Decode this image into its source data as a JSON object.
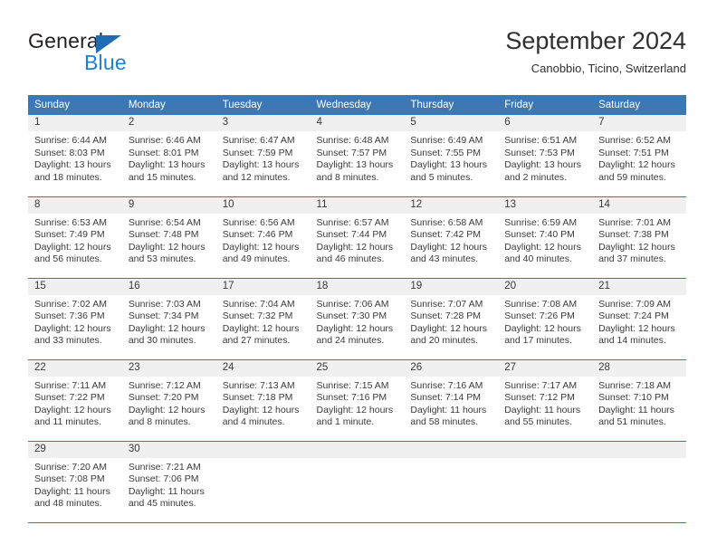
{
  "brand": {
    "name_part1": "General",
    "name_part2": "Blue",
    "triangle_color": "#1f6cb4",
    "blue_text_color": "#1f7fd4"
  },
  "header": {
    "title": "September 2024",
    "subtitle": "Canobbio, Ticino, Switzerland"
  },
  "theme": {
    "header_blue": "#3c78b4",
    "daynum_band": "#f0f0f0",
    "text": "#3a3a3a"
  },
  "columns": [
    "Sunday",
    "Monday",
    "Tuesday",
    "Wednesday",
    "Thursday",
    "Friday",
    "Saturday"
  ],
  "weeks": [
    [
      {
        "day": "1",
        "sunrise": "Sunrise: 6:44 AM",
        "sunset": "Sunset: 8:03 PM",
        "daylight1": "Daylight: 13 hours",
        "daylight2": "and 18 minutes."
      },
      {
        "day": "2",
        "sunrise": "Sunrise: 6:46 AM",
        "sunset": "Sunset: 8:01 PM",
        "daylight1": "Daylight: 13 hours",
        "daylight2": "and 15 minutes."
      },
      {
        "day": "3",
        "sunrise": "Sunrise: 6:47 AM",
        "sunset": "Sunset: 7:59 PM",
        "daylight1": "Daylight: 13 hours",
        "daylight2": "and 12 minutes."
      },
      {
        "day": "4",
        "sunrise": "Sunrise: 6:48 AM",
        "sunset": "Sunset: 7:57 PM",
        "daylight1": "Daylight: 13 hours",
        "daylight2": "and 8 minutes."
      },
      {
        "day": "5",
        "sunrise": "Sunrise: 6:49 AM",
        "sunset": "Sunset: 7:55 PM",
        "daylight1": "Daylight: 13 hours",
        "daylight2": "and 5 minutes."
      },
      {
        "day": "6",
        "sunrise": "Sunrise: 6:51 AM",
        "sunset": "Sunset: 7:53 PM",
        "daylight1": "Daylight: 13 hours",
        "daylight2": "and 2 minutes."
      },
      {
        "day": "7",
        "sunrise": "Sunrise: 6:52 AM",
        "sunset": "Sunset: 7:51 PM",
        "daylight1": "Daylight: 12 hours",
        "daylight2": "and 59 minutes."
      }
    ],
    [
      {
        "day": "8",
        "sunrise": "Sunrise: 6:53 AM",
        "sunset": "Sunset: 7:49 PM",
        "daylight1": "Daylight: 12 hours",
        "daylight2": "and 56 minutes."
      },
      {
        "day": "9",
        "sunrise": "Sunrise: 6:54 AM",
        "sunset": "Sunset: 7:48 PM",
        "daylight1": "Daylight: 12 hours",
        "daylight2": "and 53 minutes."
      },
      {
        "day": "10",
        "sunrise": "Sunrise: 6:56 AM",
        "sunset": "Sunset: 7:46 PM",
        "daylight1": "Daylight: 12 hours",
        "daylight2": "and 49 minutes."
      },
      {
        "day": "11",
        "sunrise": "Sunrise: 6:57 AM",
        "sunset": "Sunset: 7:44 PM",
        "daylight1": "Daylight: 12 hours",
        "daylight2": "and 46 minutes."
      },
      {
        "day": "12",
        "sunrise": "Sunrise: 6:58 AM",
        "sunset": "Sunset: 7:42 PM",
        "daylight1": "Daylight: 12 hours",
        "daylight2": "and 43 minutes."
      },
      {
        "day": "13",
        "sunrise": "Sunrise: 6:59 AM",
        "sunset": "Sunset: 7:40 PM",
        "daylight1": "Daylight: 12 hours",
        "daylight2": "and 40 minutes."
      },
      {
        "day": "14",
        "sunrise": "Sunrise: 7:01 AM",
        "sunset": "Sunset: 7:38 PM",
        "daylight1": "Daylight: 12 hours",
        "daylight2": "and 37 minutes."
      }
    ],
    [
      {
        "day": "15",
        "sunrise": "Sunrise: 7:02 AM",
        "sunset": "Sunset: 7:36 PM",
        "daylight1": "Daylight: 12 hours",
        "daylight2": "and 33 minutes."
      },
      {
        "day": "16",
        "sunrise": "Sunrise: 7:03 AM",
        "sunset": "Sunset: 7:34 PM",
        "daylight1": "Daylight: 12 hours",
        "daylight2": "and 30 minutes."
      },
      {
        "day": "17",
        "sunrise": "Sunrise: 7:04 AM",
        "sunset": "Sunset: 7:32 PM",
        "daylight1": "Daylight: 12 hours",
        "daylight2": "and 27 minutes."
      },
      {
        "day": "18",
        "sunrise": "Sunrise: 7:06 AM",
        "sunset": "Sunset: 7:30 PM",
        "daylight1": "Daylight: 12 hours",
        "daylight2": "and 24 minutes."
      },
      {
        "day": "19",
        "sunrise": "Sunrise: 7:07 AM",
        "sunset": "Sunset: 7:28 PM",
        "daylight1": "Daylight: 12 hours",
        "daylight2": "and 20 minutes."
      },
      {
        "day": "20",
        "sunrise": "Sunrise: 7:08 AM",
        "sunset": "Sunset: 7:26 PM",
        "daylight1": "Daylight: 12 hours",
        "daylight2": "and 17 minutes."
      },
      {
        "day": "21",
        "sunrise": "Sunrise: 7:09 AM",
        "sunset": "Sunset: 7:24 PM",
        "daylight1": "Daylight: 12 hours",
        "daylight2": "and 14 minutes."
      }
    ],
    [
      {
        "day": "22",
        "sunrise": "Sunrise: 7:11 AM",
        "sunset": "Sunset: 7:22 PM",
        "daylight1": "Daylight: 12 hours",
        "daylight2": "and 11 minutes."
      },
      {
        "day": "23",
        "sunrise": "Sunrise: 7:12 AM",
        "sunset": "Sunset: 7:20 PM",
        "daylight1": "Daylight: 12 hours",
        "daylight2": "and 8 minutes."
      },
      {
        "day": "24",
        "sunrise": "Sunrise: 7:13 AM",
        "sunset": "Sunset: 7:18 PM",
        "daylight1": "Daylight: 12 hours",
        "daylight2": "and 4 minutes."
      },
      {
        "day": "25",
        "sunrise": "Sunrise: 7:15 AM",
        "sunset": "Sunset: 7:16 PM",
        "daylight1": "Daylight: 12 hours",
        "daylight2": "and 1 minute."
      },
      {
        "day": "26",
        "sunrise": "Sunrise: 7:16 AM",
        "sunset": "Sunset: 7:14 PM",
        "daylight1": "Daylight: 11 hours",
        "daylight2": "and 58 minutes."
      },
      {
        "day": "27",
        "sunrise": "Sunrise: 7:17 AM",
        "sunset": "Sunset: 7:12 PM",
        "daylight1": "Daylight: 11 hours",
        "daylight2": "and 55 minutes."
      },
      {
        "day": "28",
        "sunrise": "Sunrise: 7:18 AM",
        "sunset": "Sunset: 7:10 PM",
        "daylight1": "Daylight: 11 hours",
        "daylight2": "and 51 minutes."
      }
    ],
    [
      {
        "day": "29",
        "sunrise": "Sunrise: 7:20 AM",
        "sunset": "Sunset: 7:08 PM",
        "daylight1": "Daylight: 11 hours",
        "daylight2": "and 48 minutes."
      },
      {
        "day": "30",
        "sunrise": "Sunrise: 7:21 AM",
        "sunset": "Sunset: 7:06 PM",
        "daylight1": "Daylight: 11 hours",
        "daylight2": "and 45 minutes."
      },
      {
        "day": "",
        "sunrise": "",
        "sunset": "",
        "daylight1": "",
        "daylight2": ""
      },
      {
        "day": "",
        "sunrise": "",
        "sunset": "",
        "daylight1": "",
        "daylight2": ""
      },
      {
        "day": "",
        "sunrise": "",
        "sunset": "",
        "daylight1": "",
        "daylight2": ""
      },
      {
        "day": "",
        "sunrise": "",
        "sunset": "",
        "daylight1": "",
        "daylight2": ""
      },
      {
        "day": "",
        "sunrise": "",
        "sunset": "",
        "daylight1": "",
        "daylight2": ""
      }
    ]
  ]
}
